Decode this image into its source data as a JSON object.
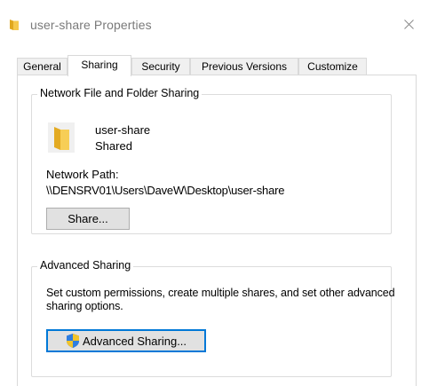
{
  "window": {
    "title": "user-share Properties",
    "close_glyph": "✕",
    "icon": "folder-icon"
  },
  "tabs": [
    {
      "label": "General",
      "active": false
    },
    {
      "label": "Sharing",
      "active": true
    },
    {
      "label": "Security",
      "active": false
    },
    {
      "label": "Previous Versions",
      "active": false
    },
    {
      "label": "Customize",
      "active": false
    }
  ],
  "network_sharing": {
    "group_title": "Network File and Folder Sharing",
    "share_name": "user-share",
    "share_status": "Shared",
    "path_label": "Network Path:",
    "path_value": "\\\\DENSRV01\\Users\\DaveW\\Desktop\\user-share",
    "share_button": "Share..."
  },
  "advanced_sharing": {
    "group_title": "Advanced Sharing",
    "description": "Set custom permissions, create multiple shares, and set other advanced sharing options.",
    "button": "Advanced Sharing...",
    "button_icon": "uac-shield-icon"
  },
  "colors": {
    "folder": "#f5c84c",
    "accent": "#0078d7",
    "title_text": "#7a7a7a"
  }
}
